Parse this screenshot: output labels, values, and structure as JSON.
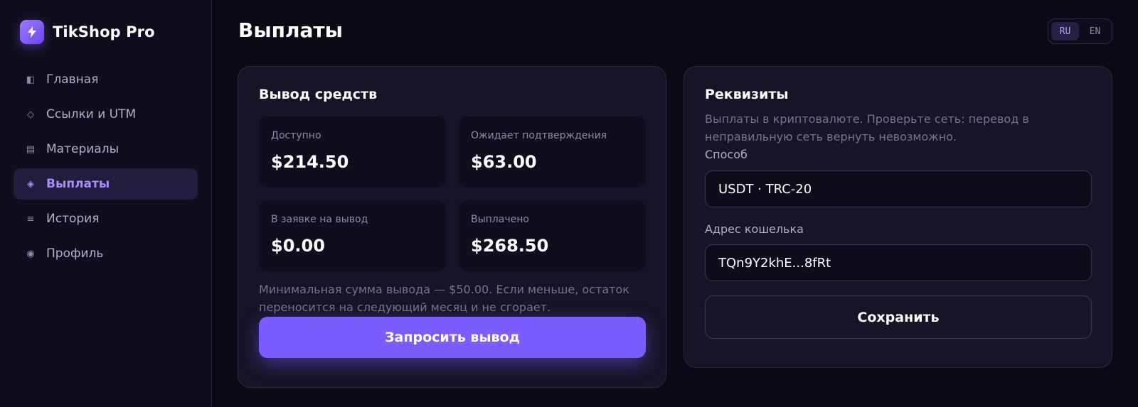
{
  "app": {
    "name": "TikShop Pro",
    "logo_icon": "lightning-icon"
  },
  "colors": {
    "accent": "#7c5cff",
    "background": "#0b0a14",
    "card": "#161427"
  },
  "sidebar": {
    "items": [
      {
        "label": "Главная",
        "icon": "dashboard-icon",
        "active": false
      },
      {
        "label": "Ссылки и UTM",
        "icon": "diamond-outline-icon",
        "active": false
      },
      {
        "label": "Материалы",
        "icon": "materials-icon",
        "active": false
      },
      {
        "label": "Выплаты",
        "icon": "payouts-icon",
        "active": true
      },
      {
        "label": "История",
        "icon": "history-icon",
        "active": false
      },
      {
        "label": "Профиль",
        "icon": "profile-icon",
        "active": false
      }
    ]
  },
  "header": {
    "title": "Выплаты",
    "languages": [
      {
        "code": "RU",
        "active": true
      },
      {
        "code": "EN",
        "active": false
      }
    ]
  },
  "withdraw": {
    "title": "Вывод средств",
    "stats": [
      {
        "label": "Доступно",
        "value": "$214.50"
      },
      {
        "label": "Ожидает подтверждения",
        "value": "$63.00"
      },
      {
        "label": "В заявке на вывод",
        "value": "$0.00"
      },
      {
        "label": "Выплачено",
        "value": "$268.50"
      }
    ],
    "note": "Минимальная сумма вывода — $50.00. Если меньше, остаток переносится на следующий месяц и не сгорает.",
    "button_label": "Запросить вывод"
  },
  "requisites": {
    "title": "Реквизиты",
    "description": "Выплаты в криптовалюте. Проверьте сеть: перевод в неправильную сеть вернуть невозможно.",
    "method_label": "Способ",
    "method_value": "USDT · TRC-20",
    "wallet_label": "Адрес кошелька",
    "wallet_value": "TQn9Y2khE...8fRt",
    "save_label": "Сохранить"
  }
}
